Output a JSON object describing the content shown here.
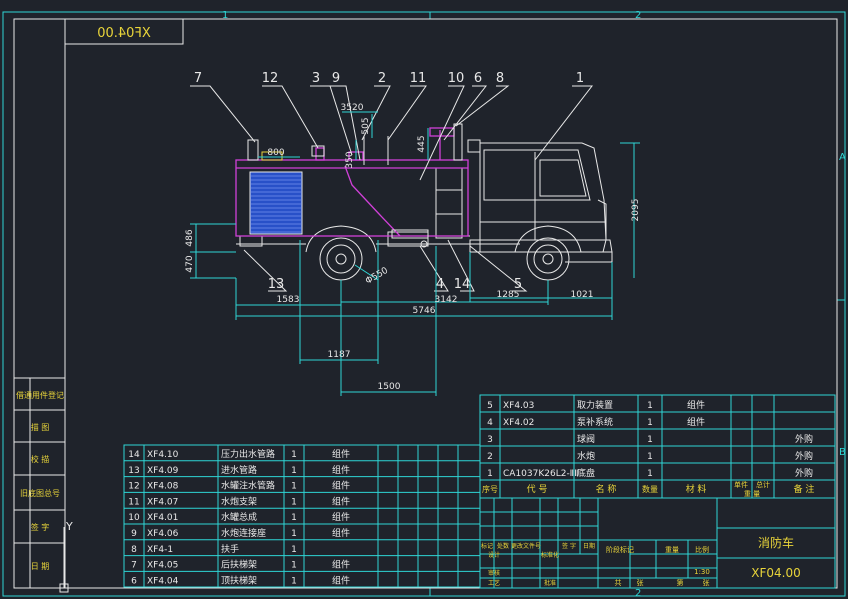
{
  "drawing_number": "XF04.00",
  "drawing_title": "消防车",
  "scale": "1:30",
  "zone_labels": {
    "col1": "1",
    "col2": "2",
    "rowA": "A",
    "rowB": "B"
  },
  "balloons": [
    "7",
    "12",
    "3",
    "9",
    "2",
    "11",
    "10",
    "6",
    "8",
    "1",
    "13",
    "4",
    "14",
    "5"
  ],
  "dimensions": {
    "d3520": "3520",
    "d800": "800",
    "d505": "505",
    "d350": "350",
    "d445": "445",
    "d2095": "2095",
    "d486": "486",
    "d470": "470",
    "d1583": "1583",
    "d3142": "3142",
    "d1285": "1285",
    "d1021": "1021",
    "d5746": "5746",
    "d1187": "1187",
    "d1500": "1500",
    "dphi": "Φ550"
  },
  "side_labels": [
    "借通用件登记",
    "描 图",
    "校 描",
    "旧底图总号",
    "签 字",
    "日 期"
  ],
  "left_bom_rows": [
    {
      "no": "14",
      "code": "XF4.10",
      "name": "压力出水管路",
      "qty": "1",
      "type": "组件"
    },
    {
      "no": "13",
      "code": "XF4.09",
      "name": "进水管路",
      "qty": "1",
      "type": "组件"
    },
    {
      "no": "12",
      "code": "XF4.08",
      "name": "水罐注水管路",
      "qty": "1",
      "type": "组件"
    },
    {
      "no": "11",
      "code": "XF4.07",
      "name": "水炮支架",
      "qty": "1",
      "type": "组件"
    },
    {
      "no": "10",
      "code": "XF4.01",
      "name": "水罐总成",
      "qty": "1",
      "type": "组件"
    },
    {
      "no": "9",
      "code": "XF4.06",
      "name": "水炮连接座",
      "qty": "1",
      "type": "组件"
    },
    {
      "no": "8",
      "code": "XF4-1",
      "name": "扶手",
      "qty": "1",
      "type": ""
    },
    {
      "no": "7",
      "code": "XF4.05",
      "name": "后扶梯架",
      "qty": "1",
      "type": "组件"
    },
    {
      "no": "6",
      "code": "XF4.04",
      "name": "顶扶梯架",
      "qty": "1",
      "type": "组件"
    }
  ],
  "right_bom_rows": [
    {
      "no": "5",
      "code": "XF4.03",
      "name": "取力装置",
      "qty": "1",
      "mat": "组件",
      "note": ""
    },
    {
      "no": "4",
      "code": "XF4.02",
      "name": "泵补系统",
      "qty": "1",
      "mat": "组件",
      "note": ""
    },
    {
      "no": "3",
      "code": "",
      "name": "球阀",
      "qty": "1",
      "mat": "",
      "note": "外购"
    },
    {
      "no": "2",
      "code": "",
      "name": "水炮",
      "qty": "1",
      "mat": "",
      "note": "外购"
    },
    {
      "no": "1",
      "code": "CA1037K26L2-ⅡⅡ",
      "name": "底盘",
      "qty": "1",
      "mat": "",
      "note": "外购"
    }
  ],
  "bom_header": {
    "no": "序号",
    "code": "代 号",
    "name": "名 称",
    "qty": "数量",
    "mat": "材 料",
    "unit_w": "单件",
    "total_w": "总计",
    "weight": "重 量",
    "note": "备 注"
  },
  "title_block": {
    "mark": "标记",
    "count": "处数",
    "doc": "更改文件号",
    "sign": "签 字",
    "date": "日期",
    "design": "设计",
    "std": "标准化",
    "stage_mark": "阶段标记",
    "weight": "重量",
    "ratio": "比例",
    "review": "审核",
    "process": "工艺",
    "approve": "批准",
    "sheet_total": "共",
    "sheet": "张",
    "sheet_no": "第",
    "sheet2": "张"
  }
}
